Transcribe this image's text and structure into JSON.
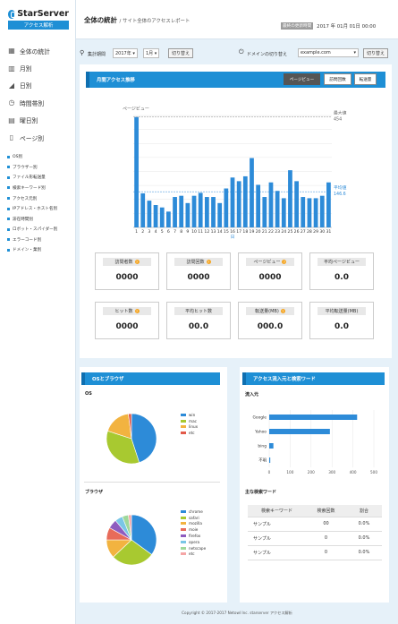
{
  "sidebar": {
    "brand": "StarServer",
    "brand_sub": "アクセス解析",
    "main_items": [
      {
        "label": "全体の統計",
        "icon": "grid-icon"
      },
      {
        "label": "月別",
        "icon": "bars-icon"
      },
      {
        "label": "日別",
        "icon": "chart-icon"
      },
      {
        "label": "時間帯別",
        "icon": "clock-icon"
      },
      {
        "label": "曜日別",
        "icon": "calendar-icon"
      },
      {
        "label": "ページ別",
        "icon": "page-icon"
      }
    ],
    "sub_items": [
      "OS別",
      "ブラウザー別",
      "ファイル形転送量",
      "検索キーワード別",
      "アクセス元別",
      "IPアドレス・ホスト名別",
      "滞在時間別",
      "ロボット・スパイダー別",
      "エラーコード別",
      "ドメイン・業別"
    ]
  },
  "header": {
    "title": "全体の統計",
    "subtitle": "/ サイト全体のアクセスレポート",
    "update_label": "最終の更新時間",
    "update_value": "2017 年 01月 01日 00:00"
  },
  "filter": {
    "period_label": "集計期間",
    "year": "2017年",
    "month": "1月",
    "switch_label": "切り替え",
    "domain_label": "ドメインの切り替え",
    "domain": "example.com",
    "domain_switch": "切り替え"
  },
  "access": {
    "title": "月間アクセス推移",
    "tabs": [
      "ページビュー",
      "訪問回数",
      "転送量"
    ],
    "chart_data": {
      "type": "bar",
      "ylabel": "ページビュー",
      "xlabel": "日",
      "categories": [
        "1",
        "2",
        "3",
        "4",
        "5",
        "6",
        "7",
        "8",
        "9",
        "10",
        "11",
        "12",
        "13",
        "14",
        "15",
        "16",
        "17",
        "18",
        "19",
        "20",
        "21",
        "22",
        "23",
        "24",
        "25",
        "26",
        "27",
        "28",
        "29",
        "30",
        "31"
      ],
      "values": [
        454,
        140,
        110,
        92,
        82,
        65,
        125,
        130,
        100,
        130,
        142,
        125,
        125,
        100,
        160,
        205,
        190,
        210,
        285,
        175,
        125,
        185,
        150,
        120,
        235,
        190,
        125,
        120,
        120,
        130,
        185
      ],
      "max_label": "最大値",
      "max_value": "454",
      "avg_label": "平均値",
      "avg_value": "146.6"
    },
    "stats": [
      {
        "label": "訪問者数",
        "help": true,
        "value": "0000"
      },
      {
        "label": "訪問回数",
        "help": true,
        "value": "0000"
      },
      {
        "label": "ページビュー",
        "help": true,
        "value": "0000"
      },
      {
        "label": "平均ページビュー",
        "help": false,
        "value": "0.0"
      },
      {
        "label": "ヒット数",
        "help": true,
        "value": "0000"
      },
      {
        "label": "平均ヒット数",
        "help": false,
        "value": "00.0"
      },
      {
        "label": "転送量(MB)",
        "help": true,
        "value": "000.0"
      },
      {
        "label": "平均転送量(MB)",
        "help": false,
        "value": "0.0"
      }
    ]
  },
  "osbrowser": {
    "title": "OSとブラウザ",
    "os_label": "OS",
    "os": [
      {
        "name": "win",
        "value": 45,
        "color": "#2d8bd8"
      },
      {
        "name": "mac",
        "value": 35,
        "color": "#a8c930"
      },
      {
        "name": "linux",
        "value": 18,
        "color": "#f2b340"
      },
      {
        "name": "etc",
        "value": 2,
        "color": "#e25a4a"
      }
    ],
    "browser_label": "ブラウザ",
    "browser": [
      {
        "name": "chrome",
        "value": 35,
        "color": "#2d8bd8"
      },
      {
        "name": "safari",
        "value": 28,
        "color": "#a8c930"
      },
      {
        "name": "mozilla",
        "value": 12,
        "color": "#f2b340"
      },
      {
        "name": "moie",
        "value": 8,
        "color": "#e86b5a"
      },
      {
        "name": "firefox",
        "value": 6,
        "color": "#8e5cbf"
      },
      {
        "name": "opera",
        "value": 5,
        "color": "#7ac6e6"
      },
      {
        "name": "netscape",
        "value": 4,
        "color": "#9fd89a"
      },
      {
        "name": "etc",
        "value": 2,
        "color": "#f5a6a6"
      }
    ]
  },
  "refs": {
    "title": "アクセス流入元と検索ワード",
    "source_label": "流入元",
    "chart_data": {
      "type": "bar",
      "categories": [
        "Google",
        "Yahoo",
        "bing",
        "不明"
      ],
      "values": [
        420,
        290,
        20,
        5
      ],
      "xlim": [
        0,
        500
      ],
      "ticks": [
        "0",
        "100",
        "200",
        "300",
        "400",
        "500"
      ]
    },
    "keyword_label": "主な検索ワード",
    "columns": [
      "検索キーワード",
      "検索回数",
      "割合"
    ],
    "rows": [
      [
        "サンプル",
        "00",
        "0.0%"
      ],
      [
        "サンプル",
        "0",
        "0.0%"
      ],
      [
        "サンプル",
        "0",
        "0.0%"
      ]
    ]
  },
  "footer": "Copyright © 2017-2017 Netowl Inc. starserver アクセス解析"
}
